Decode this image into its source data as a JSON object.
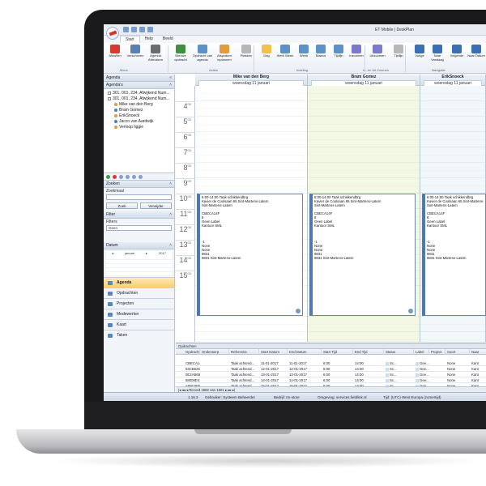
{
  "app": {
    "title": "ET Mobile | DeskPlan"
  },
  "ribbon": {
    "tabs": [
      "Start",
      "Help",
      "Beeld"
    ],
    "buttons": [
      {
        "label": "Afsluiten",
        "color": "#d33c2f"
      },
      {
        "label": "Verschoven",
        "color": "#5b7fb3"
      },
      {
        "label": "Agenda Afdrukken",
        "color": "#6d6d6d"
      },
      {
        "label": "Nieuwe opdracht",
        "color": "#3f8f3f"
      },
      {
        "label": "Opdracht van agenda",
        "color": "#5b93c9"
      },
      {
        "label": "Afspraken inplannen",
        "color": "#e39b3f"
      },
      {
        "label": "Plakken",
        "color": "#b8b8b8"
      },
      {
        "label": "Dag",
        "color": "#f0c14b"
      },
      {
        "label": "Werk Week",
        "color": "#5b93c9"
      },
      {
        "label": "Week",
        "color": "#5b93c9"
      },
      {
        "label": "Maand",
        "color": "#5b93c9"
      },
      {
        "label": "Tijdlijn",
        "color": "#5b93c9"
      },
      {
        "label": "Inzoomen",
        "color": "#7a7acb"
      },
      {
        "label": "Uitzoomen",
        "color": "#7a7acb"
      },
      {
        "label": "Tijdlijn",
        "color": "#b8b8b8"
      },
      {
        "label": "Vorige",
        "color": "#3b6fb3"
      },
      {
        "label": "Naar Vandaag",
        "color": "#3b6fb3"
      },
      {
        "label": "Volgende",
        "color": "#3b6fb3"
      },
      {
        "label": "Naar Datum",
        "color": "#3b6fb3"
      }
    ],
    "groups": [
      "Menu",
      "Acties",
      "Indeling",
      "In- en Uit Zoomen",
      "Navigatie"
    ]
  },
  "sidebar": {
    "agenda_header": "Agenda",
    "agendas_header": "Agenda's",
    "tree": [
      {
        "label": "301, 001, 234, Afwijkend Num...",
        "type": "check"
      },
      {
        "label": "301, 001, 234, Afwijkend Num...",
        "type": "check"
      },
      {
        "label": "Mike van den Berg",
        "type": "person"
      },
      {
        "label": "Bram Gomez",
        "type": "person"
      },
      {
        "label": "ErikSnoeck",
        "type": "person"
      },
      {
        "label": "Jacco van Aardwijk",
        "type": "person"
      },
      {
        "label": "Verloop liggie",
        "type": "person"
      }
    ],
    "search_header": "Zoeken",
    "search_label": "Zoekmaal",
    "search_button": "Zoek",
    "reset_button": "Verwijder",
    "filter_header": "Filter",
    "filter_label": "Filters",
    "filter_value": "Geen",
    "date_header": "Datum",
    "calendar_month": "januari",
    "calendar_year": "2017",
    "nav": [
      "Agenda",
      "Opdrachten",
      "Projecten",
      "Medewerker",
      "Kaart",
      "Taken"
    ]
  },
  "calendar": {
    "columns": [
      {
        "name": "Mike van den Berg",
        "date": "woensdag 11 januari"
      },
      {
        "name": "Bram Gomez",
        "date": "woensdag 11 januari"
      },
      {
        "name": "ErikSnoeck",
        "date": "woensdag 11 januari"
      }
    ],
    "hours": [
      "4",
      "5",
      "6",
      "7",
      "8",
      "9",
      "10",
      "11",
      "12",
      "13",
      "14",
      "15"
    ],
    "appointment_lines": [
      "6:00-14:00 Taak schikkendbrg",
      "Kavier de Coolsaan 65 Sint-Martens-Latem",
      "Sint-Martens-Latem",
      "",
      "CBECA14F",
      "8",
      "Geen Label",
      "Kantoor SML",
      "",
      "",
      "",
      "-1",
      "None",
      "None",
      "9831",
      "9831 Sint-Martens-Latem"
    ]
  },
  "orders": {
    "header": "Opdrachten",
    "columns": [
      "Opdracht ID",
      "Onderwerp",
      "Referentie",
      "Start Datum",
      "End Datum",
      "Start Tijd",
      "End Tijd",
      "Status",
      "Label",
      "Project",
      "Soort",
      "Naar"
    ],
    "rows": [
      [
        "CBECA14F",
        "",
        "Taak achtend...",
        "11-01-2017",
        "11-01-2017",
        "6:00",
        "14:00",
        "Sc...",
        "Gee...",
        "",
        "None",
        "Kant"
      ],
      [
        "63CB6267",
        "",
        "Taak achtend...",
        "12-01-2017",
        "12-01-2017",
        "6:00",
        "14:00",
        "Sc...",
        "Gee...",
        "",
        "None",
        "Kant"
      ],
      [
        "0E2AB686",
        "",
        "Taak achtend...",
        "13-01-2017",
        "13-01-2017",
        "6:00",
        "14:00",
        "Sc...",
        "Gee...",
        "",
        "None",
        "Kant"
      ],
      [
        "58008E41",
        "",
        "Taak achtend...",
        "14-01-2017",
        "14-01-2017",
        "6:00",
        "14:00",
        "Sc...",
        "Gee...",
        "",
        "None",
        "Kant"
      ],
      [
        "A89C0FE2",
        "",
        "Taak achtend...",
        "16-01-2017",
        "16-01-2017",
        "6:00",
        "14:00",
        "Sc...",
        "Gee...",
        "",
        "None",
        "Kant"
      ]
    ],
    "record_label": "Record 1582 van 1601"
  },
  "status": {
    "version": "1.16.3",
    "user": "Gebruiker: Systeem Beheerder",
    "company": "Bedrijf: Im-store",
    "env": "Omgeving: services.fieldlink.nl",
    "timezone": "Tijd: (UTC) West Europa (zomertijd)"
  }
}
